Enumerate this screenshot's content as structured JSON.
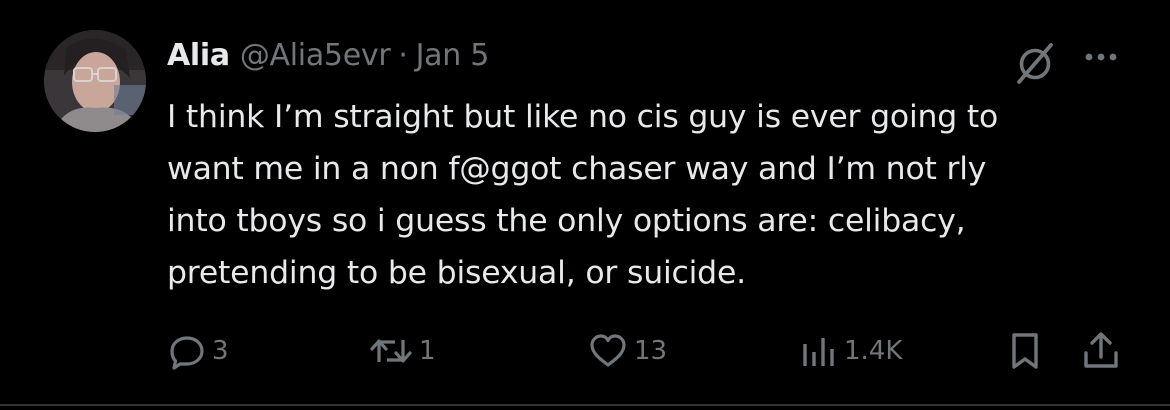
{
  "tweet": {
    "author": {
      "name": "Alia",
      "handle": "@Alia5evr"
    },
    "separator": "·",
    "date": "Jan 5",
    "text_lines": [
      "I think I’m straight but like no cis guy is ever going to",
      "want me in a non f@ggot chaser way and I’m not rly",
      "into tboys so i guess the only options are: celibacy,",
      "pretending to be bisexual, or suicide."
    ],
    "metrics": {
      "replies": "3",
      "reposts": "1",
      "likes": "13",
      "views": "1.4K"
    }
  },
  "colors": {
    "background": "#000000",
    "text": "#e7e9ea",
    "muted": "#71767b",
    "divider": "#2f3336"
  },
  "icons": {
    "header": [
      "grok-icon",
      "more-icon"
    ],
    "actions": [
      "reply-icon",
      "repost-icon",
      "like-icon",
      "views-icon",
      "bookmark-icon",
      "share-icon"
    ]
  }
}
